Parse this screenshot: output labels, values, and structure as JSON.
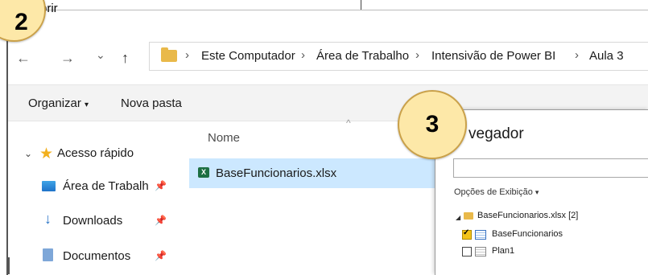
{
  "dialog": {
    "title_fragment": "brir",
    "address": {
      "crumbs": [
        "Este Computador",
        "Área de Trabalho",
        "Intensivão de Power BI",
        "Aula 3"
      ],
      "separator": "›"
    },
    "nav_buttons": {
      "back": "←",
      "forward": "→",
      "recent": "⌄",
      "up": "↑"
    },
    "command_bar": {
      "organize": "Organizar",
      "organize_caret": "▾",
      "new_folder": "Nova pasta"
    },
    "sidebar": {
      "quick_access": "Acesso rápido",
      "items": [
        {
          "label": "Área de Trabalh",
          "icon": "desktop-icon",
          "pinned": true
        },
        {
          "label": "Downloads",
          "icon": "download-icon",
          "pinned": true
        },
        {
          "label": "Documentos",
          "icon": "documents-icon",
          "pinned": true
        }
      ]
    },
    "file_list": {
      "sort_indicator": "^",
      "column_name": "Nome",
      "files": [
        {
          "name": "BaseFuncionarios.xlsx",
          "icon": "excel-icon",
          "selected": true
        }
      ]
    }
  },
  "navigator": {
    "title_fragment": "vegador",
    "view_options": "Opções de Exibição",
    "view_caret": "▾",
    "tree": {
      "root_label": "BaseFuncionarios.xlsx [2]",
      "children": [
        {
          "label": "BaseFuncionarios",
          "checked": true,
          "icon": "table-icon"
        },
        {
          "label": "Plan1",
          "checked": false,
          "icon": "sheet-icon"
        }
      ]
    }
  },
  "badges": {
    "step_two": "2",
    "step_three": "3"
  },
  "colors": {
    "selection": "#cce8ff",
    "badge_fill": "#fde8a8",
    "badge_border": "#caa14a",
    "folder": "#e9b94a",
    "star": "#f2b01e",
    "checkbox_checked": "#f3c318"
  }
}
